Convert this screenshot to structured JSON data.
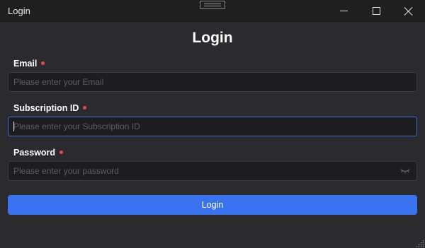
{
  "window": {
    "title": "Login",
    "controls": {
      "minimize": "minimize-icon",
      "maximize": "maximize-icon",
      "close": "close-icon"
    }
  },
  "form": {
    "heading": "Login",
    "fields": [
      {
        "label": "Email",
        "required": true,
        "value": "",
        "placeholder": "Please enter your Email"
      },
      {
        "label": "Subscription ID",
        "required": true,
        "value": "",
        "placeholder": "Please enter your Subscription ID",
        "focused": true
      },
      {
        "label": "Password",
        "required": true,
        "value": "",
        "placeholder": "Please enter your password",
        "icon": "eye-hidden-icon"
      }
    ],
    "submit_label": "Login"
  },
  "colors": {
    "background": "#2b2b2e",
    "titlebar": "#1f1f1f",
    "input_background": "#1d1d1f",
    "accent": "#3a73f0",
    "required_dot": "#e5484d"
  }
}
